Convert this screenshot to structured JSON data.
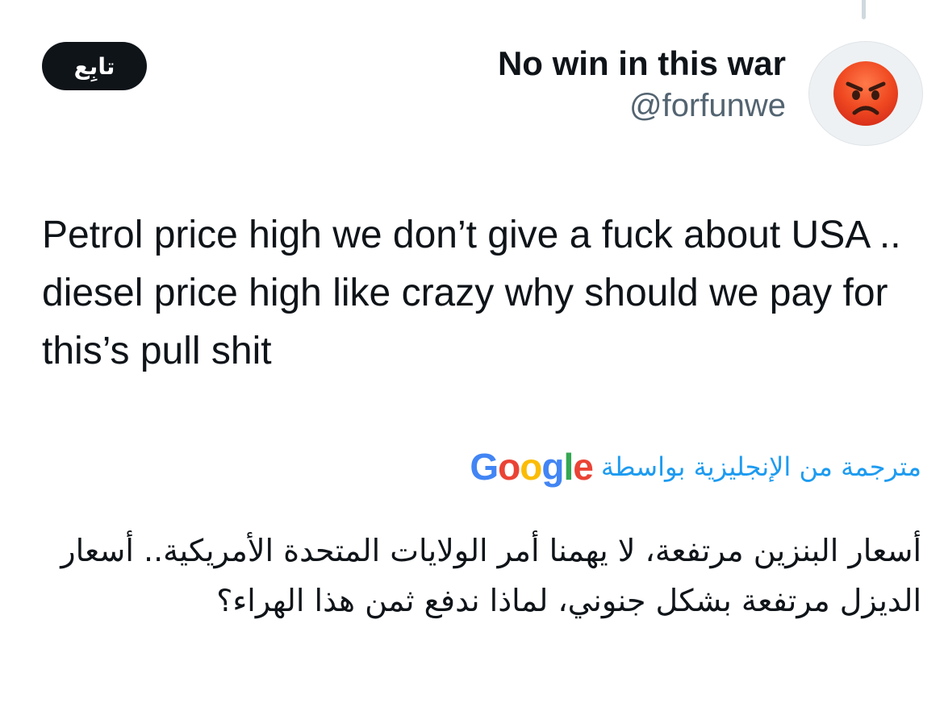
{
  "header": {
    "follow_label": "تابِع",
    "display_name": "No win in this war",
    "handle": "@forfunwe",
    "avatar_icon": "angry-face-icon"
  },
  "tweet": {
    "text": "Petrol price high we don’t give a fuck about USA .. diesel price high like crazy why should we pay for this’s pull shit"
  },
  "translation": {
    "attribution": "مترجمة من الإنجليزية بواسطة",
    "provider_letters": [
      "G",
      "o",
      "o",
      "g",
      "l",
      "e"
    ],
    "provider_colors": [
      "#4285F4",
      "#EA4335",
      "#FBBC05",
      "#4285F4",
      "#34A853",
      "#EA4335"
    ],
    "text": "أسعار البنزين مرتفعة، لا يهمنا أمر الولايات المتحدة الأمريكية.. أسعار الديزل مرتفعة بشكل جنوني، لماذا ندفع ثمن هذا الهراء؟"
  },
  "colors": {
    "link": "#1d9bf0",
    "secondary_text": "#536471",
    "button_bg": "#0f1419"
  }
}
